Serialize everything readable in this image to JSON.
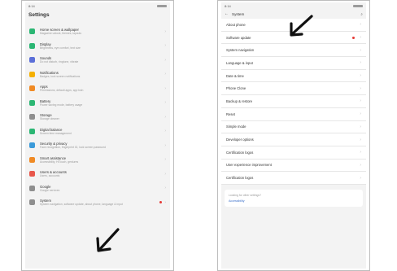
{
  "left_screen": {
    "status_time": "8:14",
    "title": "Settings",
    "items": [
      {
        "title": "Home screen & wallpaper",
        "subtitle": "Magazine unlock, themes, layouts",
        "icon": "wallpaper-icon",
        "color": "#2bb673"
      },
      {
        "title": "Display",
        "subtitle": "Brightness, eye comfort, text size",
        "icon": "display-icon",
        "color": "#2bb673"
      },
      {
        "title": "Sounds",
        "subtitle": "Do not disturb, ringtone, vibrate",
        "icon": "sound-icon",
        "color": "#5b6fd8"
      },
      {
        "title": "Notifications",
        "subtitle": "Badges, lock screen notifications",
        "icon": "bell-icon",
        "color": "#f5b000"
      },
      {
        "title": "Apps",
        "subtitle": "Permissions, default apps, app twin",
        "icon": "apps-icon",
        "color": "#f08a24"
      },
      {
        "title": "Battery",
        "subtitle": "Power saving mode, battery usage",
        "icon": "battery-icon",
        "color": "#2bb673"
      },
      {
        "title": "Storage",
        "subtitle": "Storage cleaner",
        "icon": "storage-icon",
        "color": "#8e8e8e"
      },
      {
        "title": "Digital balance",
        "subtitle": "Screen time management",
        "icon": "balance-icon",
        "color": "#2bb673"
      },
      {
        "title": "Security & privacy",
        "subtitle": "Face recognition, fingerprint ID, lock screen password",
        "icon": "shield-icon",
        "color": "#3a9ad9"
      },
      {
        "title": "Smart assistance",
        "subtitle": "Accessibility, HiTouch, gestures",
        "icon": "assist-icon",
        "color": "#f08a24"
      },
      {
        "title": "Users & accounts",
        "subtitle": "Users, accounts",
        "icon": "users-icon",
        "color": "#e8574b"
      },
      {
        "title": "Google",
        "subtitle": "Google services",
        "icon": "google-icon",
        "color": "#8e8e8e"
      },
      {
        "title": "System",
        "subtitle": "System navigation, software update, about phone, language & input",
        "icon": "system-icon",
        "color": "#8e8e8e",
        "badge": true
      }
    ]
  },
  "right_screen": {
    "status_time": "8:14",
    "title": "System",
    "items": [
      {
        "label": "About phone",
        "value": ""
      },
      {
        "label": "Software update",
        "value": "",
        "badge": true
      },
      {
        "label": "System navigation",
        "value": ""
      },
      {
        "label": "Language & input",
        "value": ""
      },
      {
        "label": "Date & time",
        "value": ""
      },
      {
        "label": "Phone Clone",
        "value": ""
      },
      {
        "label": "Backup & restore",
        "value": ""
      },
      {
        "label": "Reset",
        "value": ""
      },
      {
        "label": "Simple mode",
        "value": ""
      },
      {
        "label": "Developer options",
        "value": ""
      },
      {
        "label": "Certification logos",
        "value": ""
      },
      {
        "label": "User experience improvement",
        "value": ""
      },
      {
        "label": "Certification logos",
        "value": ""
      }
    ],
    "footer_text": "Looking for other settings?",
    "footer_link": "Accessibility"
  }
}
